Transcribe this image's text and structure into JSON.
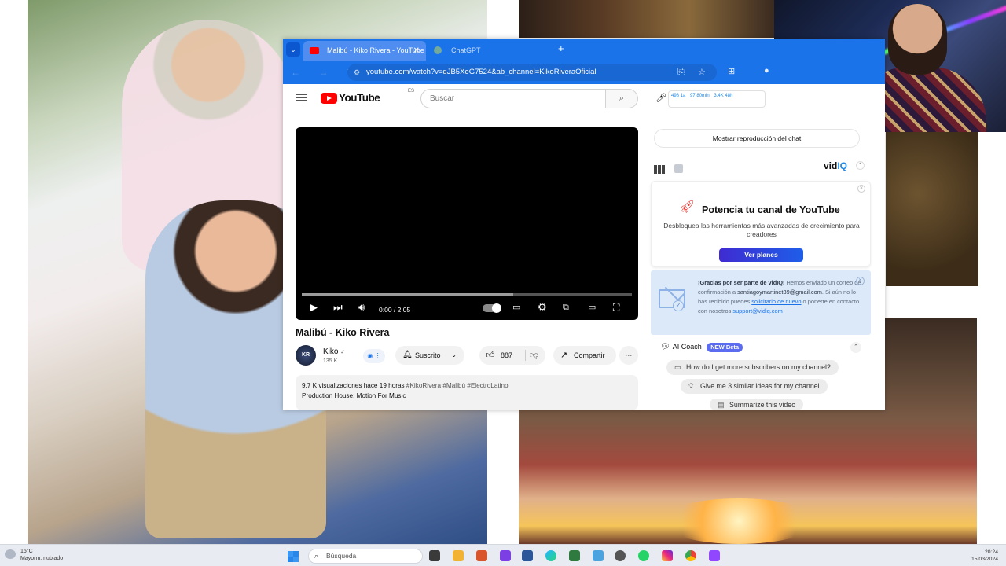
{
  "browser": {
    "tabs": [
      {
        "label": "Malibú - Kiko Rivera - YouTube",
        "active": true
      },
      {
        "label": "ChatGPT",
        "active": false
      }
    ],
    "url": "youtube.com/watch?v=qJB5XeG7524&ab_channel=KikoRiveraOficial"
  },
  "youtube": {
    "logo_text": "YouTube",
    "country_code": "ES",
    "search_placeholder": "Buscar",
    "vidiq_stats": [
      "498 1a",
      "97 80min",
      "3.4K 48h"
    ],
    "video": {
      "time": "0:00 / 2:05",
      "progress_fraction": 0.0,
      "buffered_fraction": 0.64
    },
    "title": "Malibú - Kiko Rivera",
    "channel": {
      "avatar_text": "KR",
      "name": "Kiko",
      "verified": "✓",
      "subs": "135 K"
    },
    "subscribe_label": "Suscrito",
    "likes": "887",
    "share_label": "Compartir",
    "more_label": "···",
    "description": {
      "views": "9,7 K visualizaciones  hace 19 horas",
      "tags": "#KikoRivera #Malibú #ElectroLatino",
      "line2": "Production House: Motion For Music"
    }
  },
  "sidebar": {
    "chat_replay": "Mostrar reproducción del chat",
    "vidiq_logo": {
      "vid": "vid",
      "iq": "IQ"
    },
    "promo": {
      "title": "Potencia tu canal de YouTube",
      "subtitle": "Desbloquea las herramientas más avanzadas de crecimiento para creadores",
      "cta": "Ver planes"
    },
    "notice": {
      "bold": "¡Gracias por ser parte de vidIQ!",
      "part1": " Hemos enviado un correo de confirmación a ",
      "email": "santiagoymartinet39@gmail.com",
      "part2": ". Si aún no lo has recibido puedes ",
      "link1": "solicitarlo de nuevo",
      "part3": " o ponerte en contacto con nosotros ",
      "link2": "support@vidiq.com"
    },
    "coach": {
      "title": "AI Coach",
      "badge": "NEW Beta",
      "suggestions": [
        "How do I get more subscribers on my channel?",
        "Give me 3 similar ideas for my channel",
        "Summarize this video"
      ]
    }
  },
  "taskbar": {
    "weather_temp": "15°C",
    "weather_desc": "Mayorm. nublado",
    "search_label": "Búsqueda",
    "time": "20:24",
    "date": "15/03/2024"
  },
  "colors": {
    "chrome_blue": "#1a73e8",
    "youtube_red": "#ff0000",
    "vidiq_blue": "#1e88e5"
  }
}
